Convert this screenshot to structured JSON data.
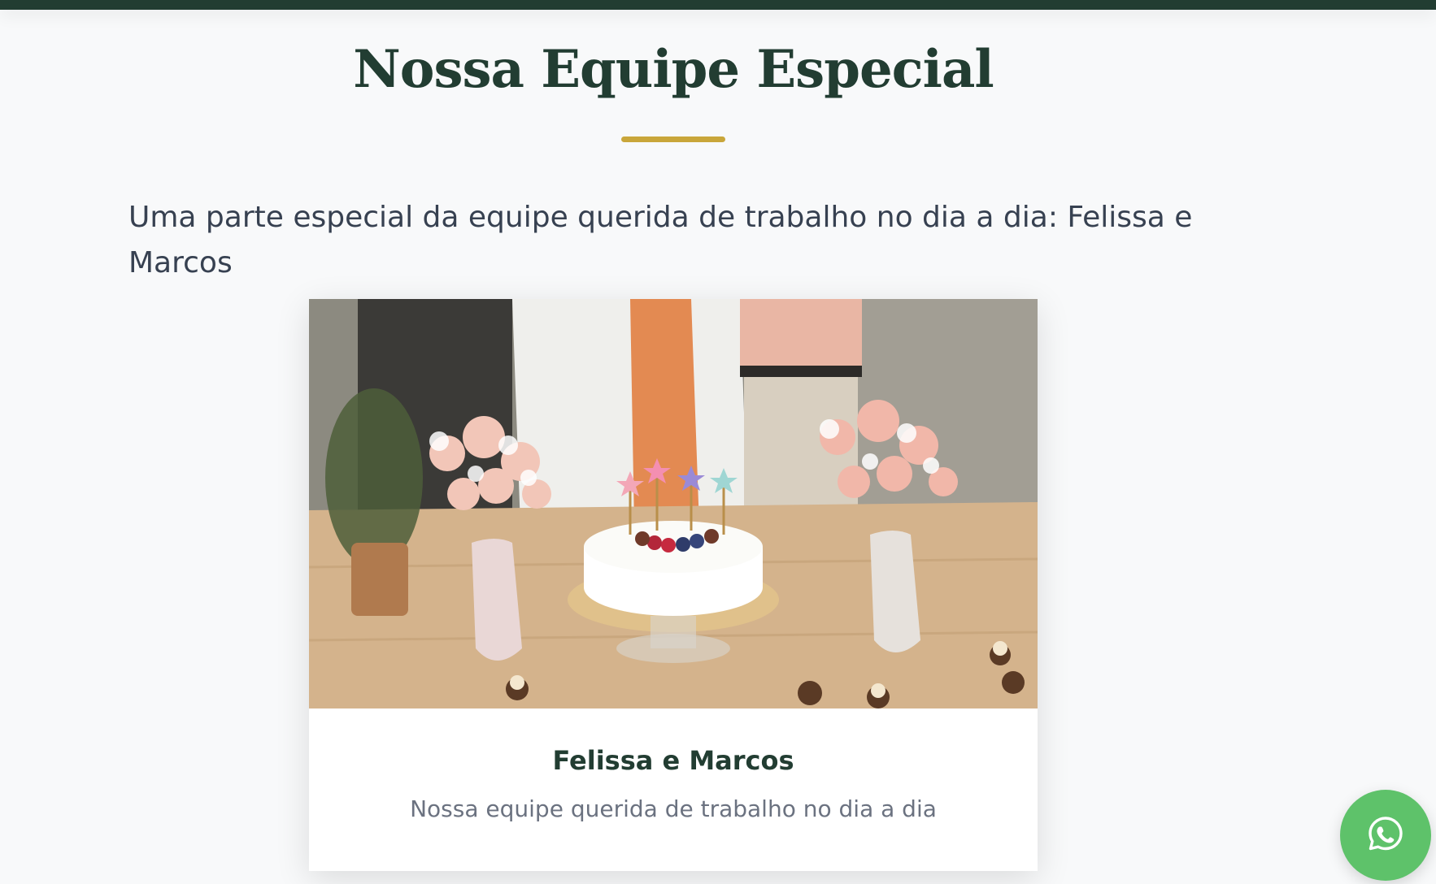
{
  "section": {
    "title": "Nossa Equipe Especial",
    "intro": "Uma parte especial da equipe querida de trabalho no dia a dia: Felissa e Marcos"
  },
  "card": {
    "photo_alt": "Felissa e Marcos",
    "name": "Felissa e Marcos",
    "description": "Nossa equipe querida de trabalho no dia a dia"
  },
  "floating": {
    "icon": "whatsapp-icon"
  },
  "colors": {
    "brand_dark": "#223d32",
    "accent_gold": "#c9a63a",
    "whatsapp_green": "#5ec26a"
  }
}
